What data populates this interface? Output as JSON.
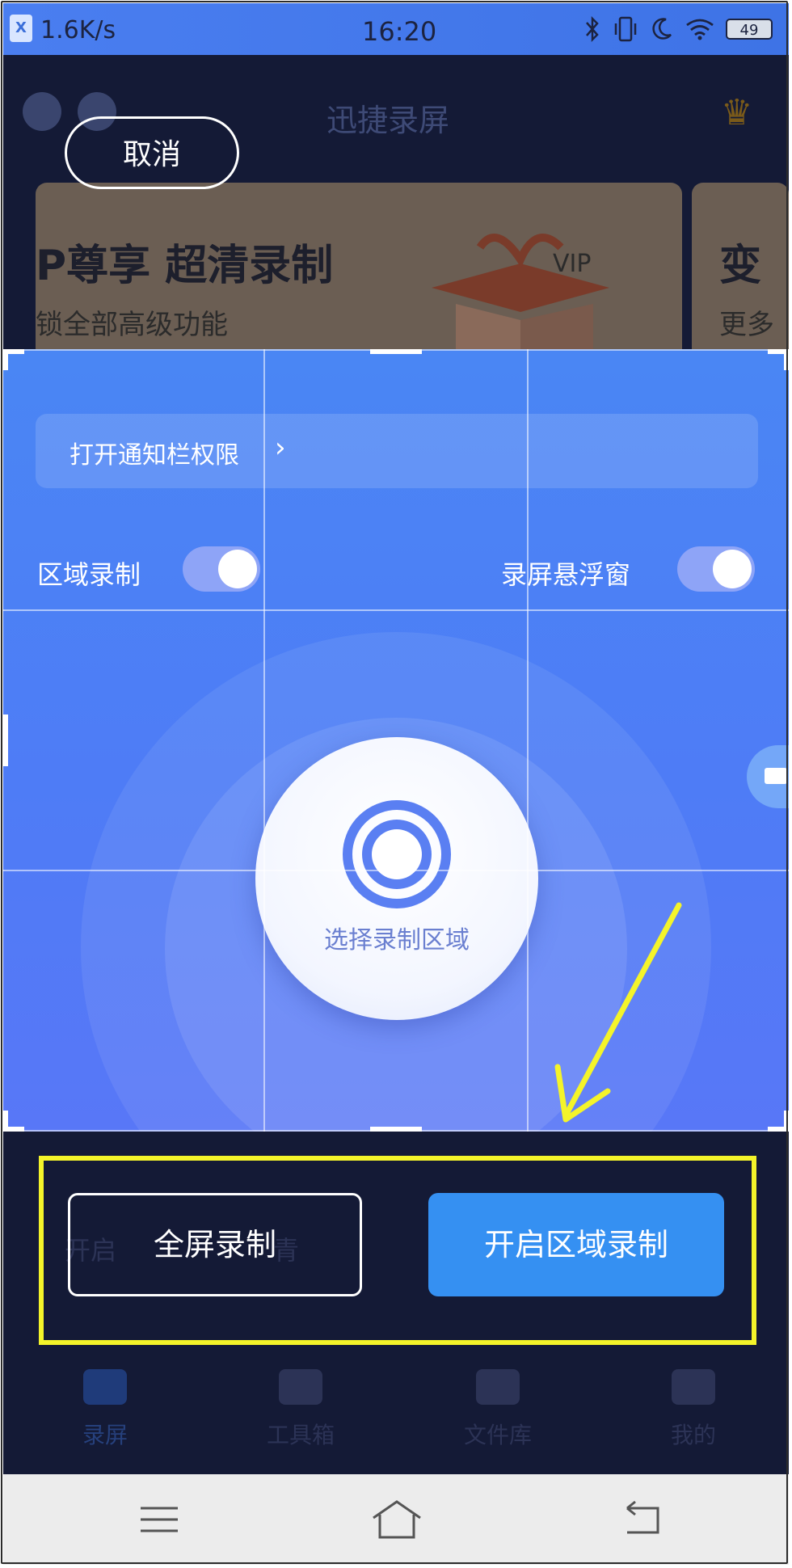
{
  "status_bar": {
    "app_badge": "X",
    "net_speed": "1.6K/s",
    "time": "16:20",
    "battery": "49"
  },
  "header": {
    "title": "迅捷录屏"
  },
  "banner": {
    "title": "P尊享 超清录制",
    "subtitle": "锁全部高级功能",
    "next_title": "变",
    "next_subtitle": "更多"
  },
  "overlay": {
    "cancel_label": "取消"
  },
  "notification": {
    "label": "打开通知栏权限",
    "chevron": "›"
  },
  "toggles": {
    "region_record_label": "区域录制",
    "float_window_label": "录屏悬浮窗"
  },
  "record_disc": {
    "label": "选择录制区域"
  },
  "panel_background": {
    "left_text": "开启",
    "mid_text": "青"
  },
  "actions": {
    "full_screen_label": "全屏录制",
    "region_start_label": "开启区域录制"
  },
  "tabs": [
    {
      "label": "录屏",
      "icon": "video-camera-icon"
    },
    {
      "label": "工具箱",
      "icon": "toolbox-icon"
    },
    {
      "label": "文件库",
      "icon": "folder-icon"
    },
    {
      "label": "我的",
      "icon": "profile-icon"
    }
  ],
  "colors": {
    "region_blue": "#4e7cf6",
    "highlight_yellow": "#f4f42a",
    "primary_button": "#3590f2",
    "backdrop": "#141a36"
  }
}
